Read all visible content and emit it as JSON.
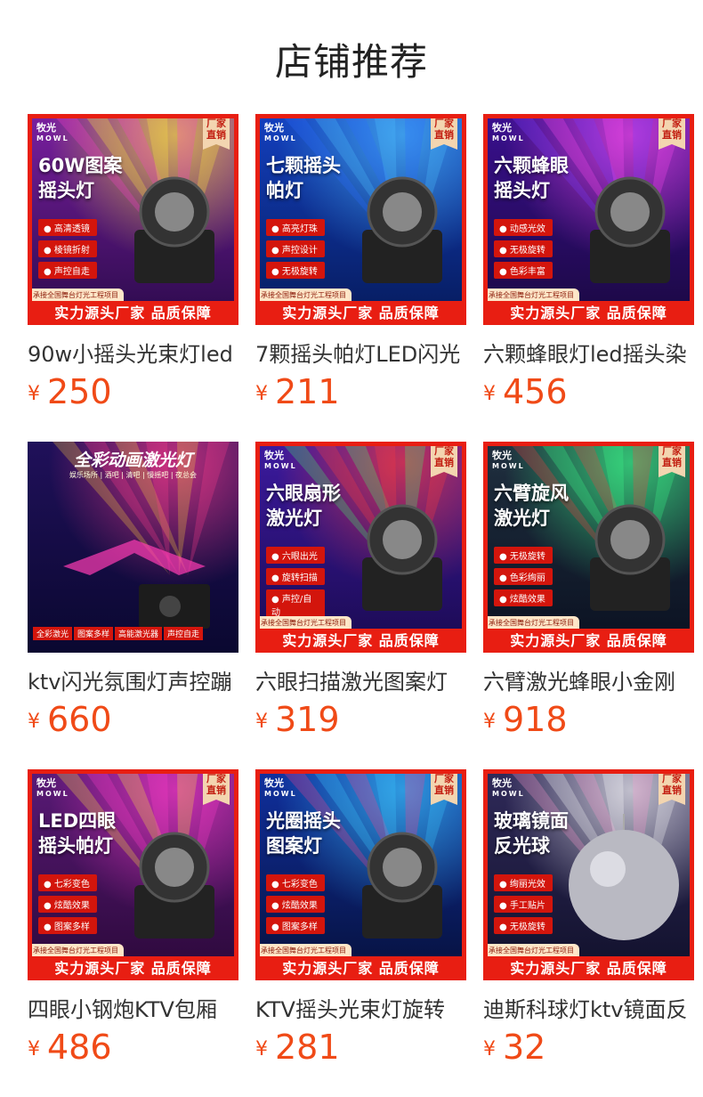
{
  "page": {
    "title": "店铺推荐"
  },
  "products": [
    {
      "name": "90w小摇头光束灯led",
      "price": "250",
      "currency": "¥",
      "image": {
        "headline": [
          "60W图案",
          "摇头灯"
        ],
        "features": [
          "高清透镜",
          "棱镜折射",
          "声控自走"
        ],
        "style": "mowl"
      }
    },
    {
      "name": "7颗摇头帕灯LED闪光",
      "price": "211",
      "currency": "¥",
      "image": {
        "headline": [
          "七颗摇头",
          "帕灯"
        ],
        "features": [
          "高亮灯珠",
          "声控设计",
          "无极旋转"
        ],
        "style": "mowl"
      }
    },
    {
      "name": "六颗蜂眼灯led摇头染",
      "price": "456",
      "currency": "¥",
      "image": {
        "headline": [
          "六颗蜂眼",
          "摇头灯"
        ],
        "features": [
          "动感光效",
          "无极旋转",
          "色彩丰富"
        ],
        "style": "mowl"
      }
    },
    {
      "name": "ktv闪光氛围灯声控蹦",
      "price": "660",
      "currency": "¥",
      "image": {
        "banner": "全彩动画激光灯",
        "sub": "娱乐场所 | 酒吧 | 清吧 | 慢摇吧 | 夜总会",
        "tags": [
          "全彩激光",
          "图案多样",
          "高能激光器",
          "声控自走"
        ],
        "style": "laser"
      }
    },
    {
      "name": "六眼扫描激光图案灯",
      "price": "319",
      "currency": "¥",
      "image": {
        "headline": [
          "六眼扇形",
          "激光灯"
        ],
        "features": [
          "六眼出光",
          "旋转扫描",
          "声控/自动"
        ],
        "style": "mowl"
      }
    },
    {
      "name": "六臂激光蜂眼小金刚",
      "price": "918",
      "currency": "¥",
      "image": {
        "headline": [
          "六臂旋风",
          "激光灯"
        ],
        "features": [
          "无极旋转",
          "色彩绚丽",
          "炫酷效果"
        ],
        "style": "mowl"
      }
    },
    {
      "name": "四眼小钢炮KTV包厢",
      "price": "486",
      "currency": "¥",
      "image": {
        "headline": [
          "LED四眼",
          "摇头帕灯"
        ],
        "features": [
          "七彩变色",
          "炫酷效果",
          "图案多样"
        ],
        "style": "mowl"
      }
    },
    {
      "name": "KTV摇头光束灯旋转",
      "price": "281",
      "currency": "¥",
      "image": {
        "headline": [
          "光圈摇头",
          "图案灯"
        ],
        "features": [
          "七彩变色",
          "炫酷效果",
          "图案多样"
        ],
        "style": "mowl"
      }
    },
    {
      "name": "迪斯科球灯ktv镜面反",
      "price": "32",
      "currency": "¥",
      "image": {
        "headline": [
          "玻璃镜面",
          "反光球"
        ],
        "features": [
          "绚丽光效",
          "手工贴片",
          "无极旋转"
        ],
        "style": "mowl"
      }
    }
  ],
  "common": {
    "brand_cn": "牧光",
    "brand_en": "MOWL",
    "corner_badge": [
      "厂家",
      "直销"
    ],
    "footer_top": "承接全国舞台灯光工程项目",
    "footer_bar": "实力源头厂家 品质保障"
  },
  "colors": {
    "price": "#f04a17",
    "frame_red": "#e81e12",
    "badge_bg": "#f3d5b0"
  }
}
